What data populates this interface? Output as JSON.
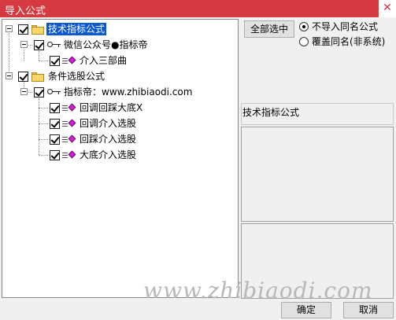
{
  "window": {
    "title": "导入公式",
    "close_glyph": "✕"
  },
  "tree": {
    "groups": [
      {
        "label": "技术指标公式",
        "checked": true,
        "selected": true,
        "children": [
          {
            "label": "微信公众号●指标帝",
            "checked": true,
            "items": [
              {
                "label": "介入三部曲",
                "checked": true
              }
            ]
          }
        ]
      },
      {
        "label": "条件选股公式",
        "checked": true,
        "selected": false,
        "children": [
          {
            "label": "指标帝：www.zhibiaodi.com",
            "checked": true,
            "items": [
              {
                "label": "回调回踩大底X",
                "checked": true
              },
              {
                "label": "回调介入选股",
                "checked": true
              },
              {
                "label": "回踩介入选股",
                "checked": true
              },
              {
                "label": "大底介入选股",
                "checked": true
              }
            ]
          }
        ]
      }
    ]
  },
  "right": {
    "select_all_label": "全部选中",
    "options": [
      {
        "label": "不导入同名公式",
        "selected": true
      },
      {
        "label": "覆盖同名(非系统)",
        "selected": false
      }
    ],
    "info_label": "技术指标公式"
  },
  "footer": {
    "ok_label": "确定",
    "cancel_label": "取消"
  },
  "watermark": "www.zhibiaodi.com"
}
